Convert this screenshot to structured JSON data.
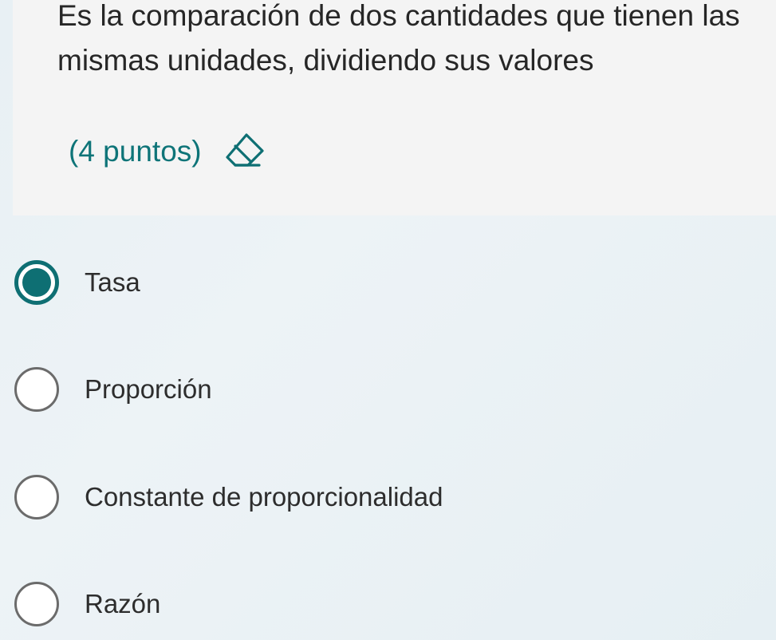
{
  "question": {
    "text": "Es la comparación de dos cantidades que tienen las mismas unidades, dividiendo sus valores",
    "points": "(4 puntos)",
    "eraser_icon": "eraser-icon"
  },
  "colors": {
    "accent": "#0e6f73",
    "points_text": "#0e7478"
  },
  "options": [
    {
      "label": "Tasa",
      "selected": true
    },
    {
      "label": "Proporción",
      "selected": false
    },
    {
      "label": "Constante de proporcionalidad",
      "selected": false
    },
    {
      "label": "Razón",
      "selected": false
    }
  ]
}
